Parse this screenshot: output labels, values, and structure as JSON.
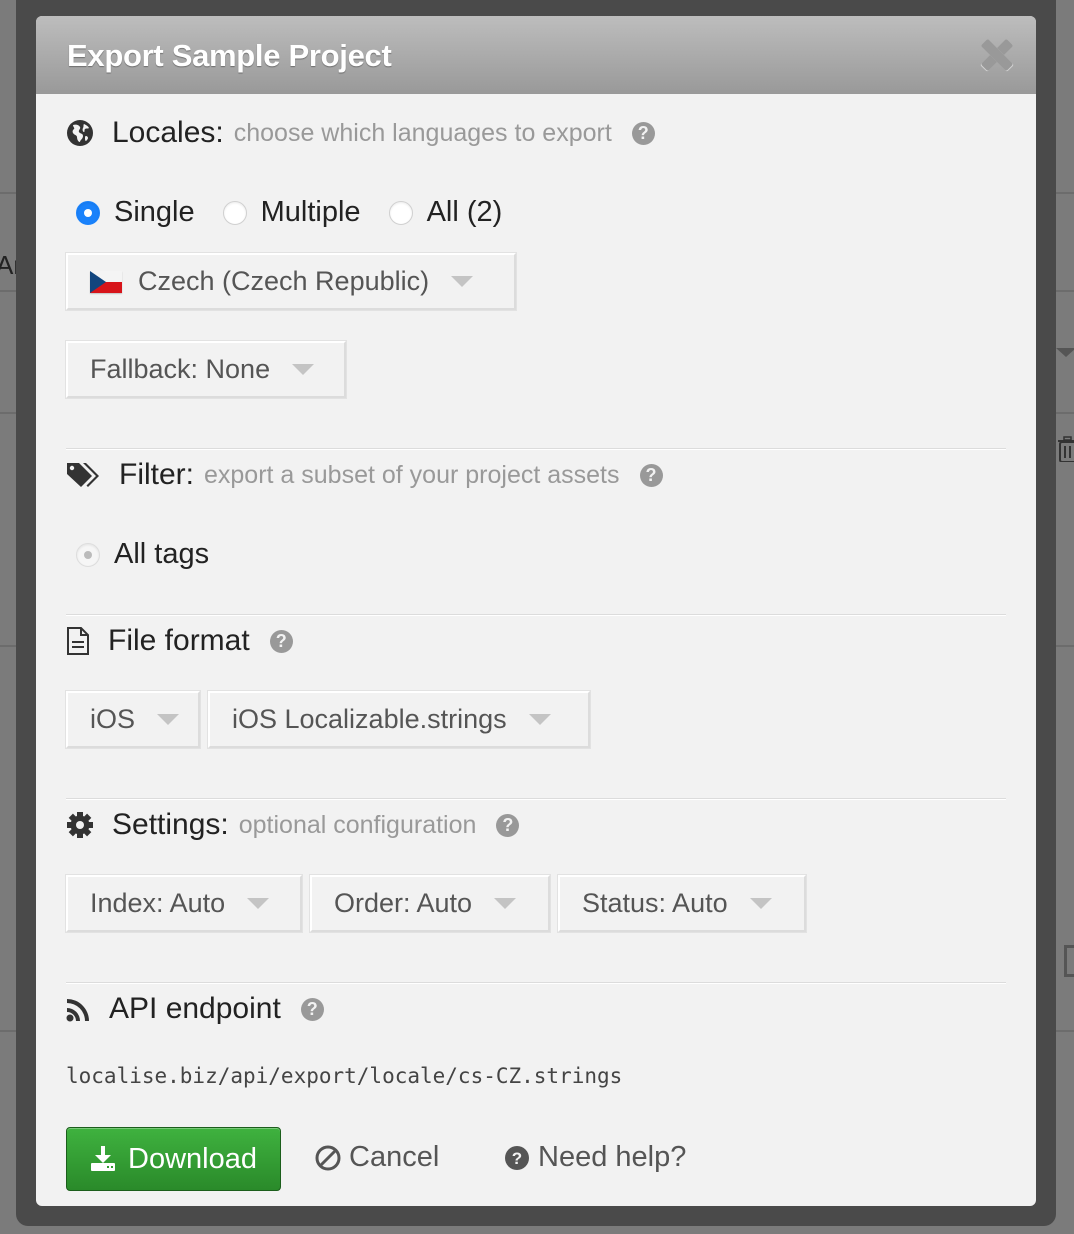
{
  "background": {
    "partial_text": "Any"
  },
  "dialog": {
    "title": "Export Sample Project",
    "close_icon": "close-icon"
  },
  "locales": {
    "icon": "globe-icon",
    "title": "Locales:",
    "subtitle": "choose which languages to export",
    "modes": [
      {
        "label": "Single",
        "selected": true
      },
      {
        "label": "Multiple",
        "selected": false
      },
      {
        "label": "All (2)",
        "selected": false
      }
    ],
    "locale_select": {
      "value": "Czech (Czech Republic)",
      "flag": "cz-flag-icon"
    },
    "fallback_select": {
      "value": "Fallback: None"
    }
  },
  "filter": {
    "icon": "tags-icon",
    "title": "Filter:",
    "subtitle": "export a subset of your project assets",
    "options": [
      {
        "label": "All tags",
        "selected": true,
        "disabled": true
      }
    ]
  },
  "file_format": {
    "icon": "file-text-icon",
    "title": "File format",
    "platform_select": {
      "value": "iOS"
    },
    "format_select": {
      "value": "iOS Localizable.strings"
    }
  },
  "settings": {
    "icon": "gear-icon",
    "title": "Settings:",
    "subtitle": "optional configuration",
    "selects": [
      {
        "value": "Index: Auto"
      },
      {
        "value": "Order: Auto"
      },
      {
        "value": "Status: Auto"
      }
    ]
  },
  "api": {
    "icon": "rss-icon",
    "title": "API endpoint",
    "endpoint": "localise.biz/api/export/locale/cs-CZ.strings"
  },
  "actions": {
    "download_label": "Download",
    "cancel_label": "Cancel",
    "help_label": "Need help?"
  },
  "colors": {
    "primary_green": "#2e9a2e",
    "radio_selected": "#1a82fb",
    "header_gradient_top": "#bdbdbd",
    "header_gradient_bottom": "#999999"
  }
}
